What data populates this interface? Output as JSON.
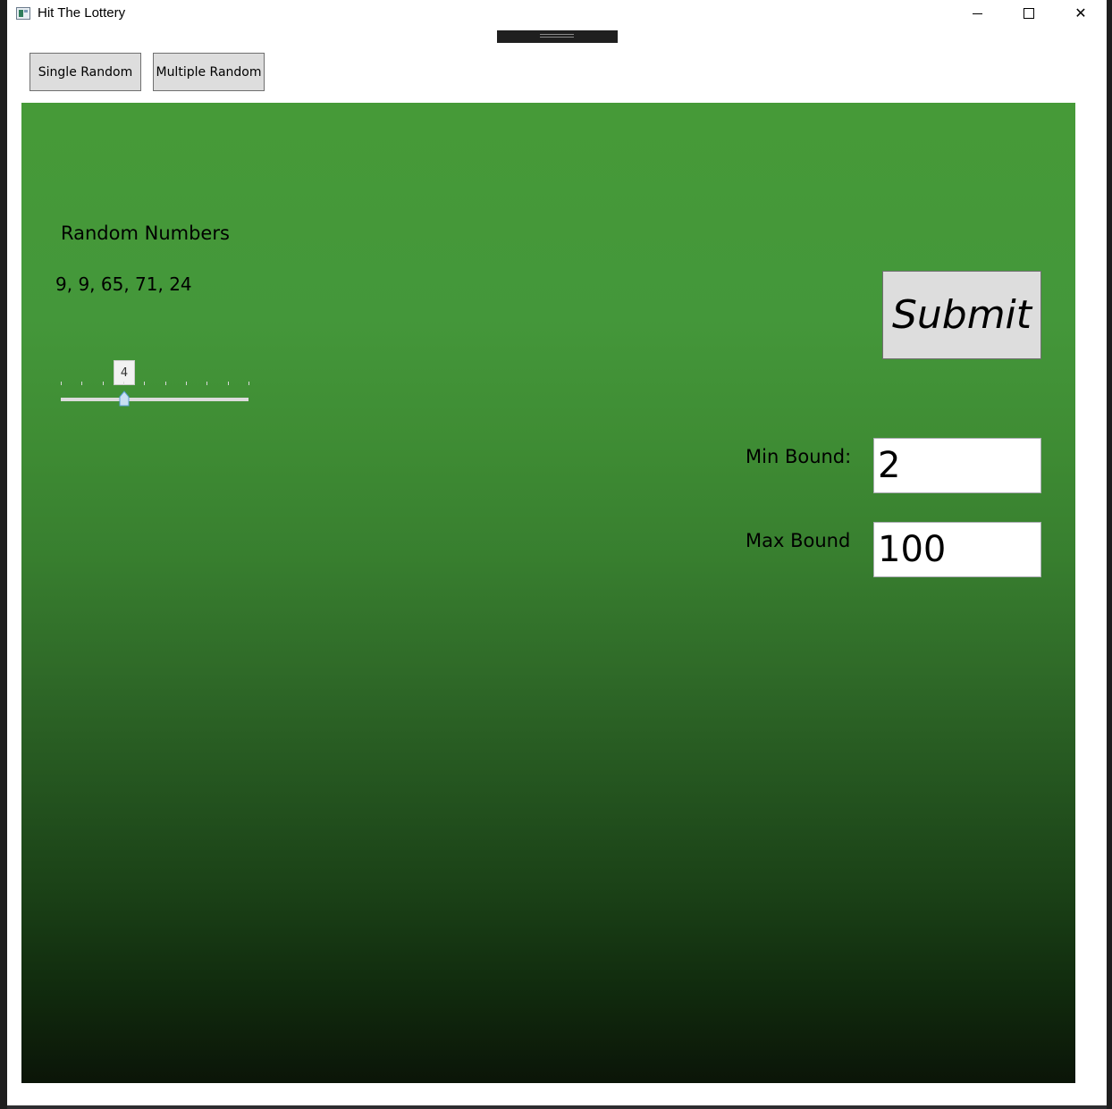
{
  "window": {
    "title": "Hit The Lottery",
    "minimize_icon": "minimize-icon",
    "maximize_icon": "maximize-icon",
    "close_icon": "close-icon"
  },
  "tabs": [
    {
      "label": "Single Random"
    },
    {
      "label": "Multiple Random"
    }
  ],
  "main": {
    "random_title": "Random Numbers",
    "random_values": "9, 9, 65, 71, 24",
    "slider": {
      "value": 4,
      "min": 1,
      "max": 10,
      "display": "4"
    },
    "submit_label": "Submit",
    "min_bound_label": "Min Bound:",
    "min_bound_value": "2",
    "max_bound_label": "Max Bound",
    "max_bound_value": "100"
  },
  "colors": {
    "panel_top": "#469a38",
    "panel_bottom": "#0b1508",
    "button_bg": "#dddddd",
    "slider_thumb": "#c8dff2"
  }
}
